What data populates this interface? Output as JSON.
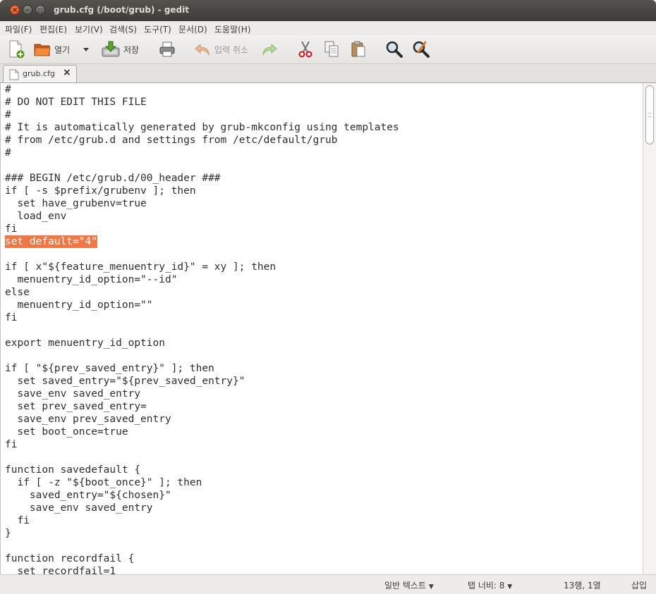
{
  "window": {
    "title": "grub.cfg (/boot/grub) - gedit"
  },
  "menu": {
    "items": [
      "파일(F)",
      "편집(E)",
      "보기(V)",
      "검색(S)",
      "도구(T)",
      "문서(D)",
      "도움말(H)"
    ]
  },
  "toolbar": {
    "open_label": "열기",
    "save_label": "저장",
    "undo_label": "입력 취소"
  },
  "tab": {
    "title": "grub.cfg"
  },
  "editor": {
    "lines": [
      "#",
      "# DO NOT EDIT THIS FILE",
      "#",
      "# It is automatically generated by grub-mkconfig using templates",
      "# from /etc/grub.d and settings from /etc/default/grub",
      "#",
      "",
      "### BEGIN /etc/grub.d/00_header ###",
      "if [ -s $prefix/grubenv ]; then",
      "  set have_grubenv=true",
      "  load_env",
      "fi",
      "set default=\"4\"",
      "",
      "if [ x\"${feature_menuentry_id}\" = xy ]; then",
      "  menuentry_id_option=\"--id\"",
      "else",
      "  menuentry_id_option=\"\"",
      "fi",
      "",
      "export menuentry_id_option",
      "",
      "if [ \"${prev_saved_entry}\" ]; then",
      "  set saved_entry=\"${prev_saved_entry}\"",
      "  save_env saved_entry",
      "  set prev_saved_entry=",
      "  save_env prev_saved_entry",
      "  set boot_once=true",
      "fi",
      "",
      "function savedefault {",
      "  if [ -z \"${boot_once}\" ]; then",
      "    saved_entry=\"${chosen}\"",
      "    save_env saved_entry",
      "  fi",
      "}",
      "",
      "function recordfail {",
      "  set recordfail=1"
    ],
    "highlighted_line": 13,
    "highlight_color": "#f07746"
  },
  "status": {
    "language": "일반 텍스트",
    "tab_width": "탭 너비:  8",
    "position": "13행, 1열",
    "mode": "삽입"
  }
}
